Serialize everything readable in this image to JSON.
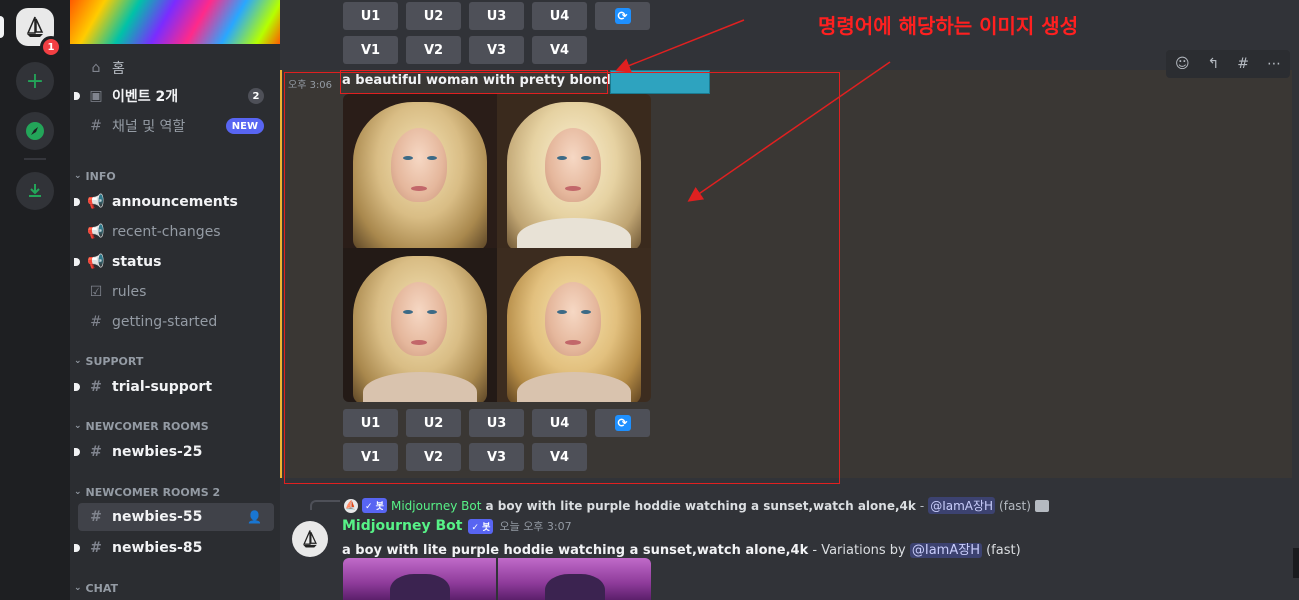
{
  "rail": {
    "badge": "1"
  },
  "sidebar": {
    "home": "홈",
    "events": "이벤트 2개",
    "events_count": "2",
    "channels_roles": "채널 및 역할",
    "new_tag": "NEW",
    "categories": {
      "info": "INFO",
      "support": "SUPPORT",
      "newcomer": "NEWCOMER ROOMS",
      "newcomer2": "NEWCOMER ROOMS 2",
      "chat": "CHAT"
    },
    "channels": {
      "announcements": "announcements",
      "recent_changes": "recent-changes",
      "status": "status",
      "rules": "rules",
      "getting_started": "getting-started",
      "trial_support": "trial-support",
      "newbies25": "newbies-25",
      "newbies55": "newbies-55",
      "newbies85": "newbies-85"
    }
  },
  "buttons": {
    "u": [
      "U1",
      "U2",
      "U3",
      "U4"
    ],
    "v": [
      "V1",
      "V2",
      "V3",
      "V4"
    ],
    "refresh_icon": "refresh-icon"
  },
  "message1": {
    "time": "오후 3:06",
    "prompt": "a beautiful woman with pretty blond hair",
    "dash": " -"
  },
  "annotation": {
    "text": "명령어에 해당하는 이미지 생성",
    "color": "#ff2020"
  },
  "reply": {
    "author": "Midjourney Bot",
    "prompt": "a boy with lite purple hoddie watching a sunset,watch alone,4k",
    "sep": " - ",
    "mention": "@IamA장H",
    "speed": "(fast)"
  },
  "message2": {
    "author": "Midjourney Bot",
    "bot_tag": "✓ 봇",
    "time": "오늘 오후 3:07",
    "prompt": "a boy with lite purple hoddie watching a sunset,watch alone,4k",
    "suffix": " - Variations by ",
    "mention": "@IamA장H",
    "speed": " (fast)"
  },
  "colors": {
    "accent": "#5865f2",
    "highlight_border": "#f0b232",
    "bot_green": "#57f287"
  }
}
